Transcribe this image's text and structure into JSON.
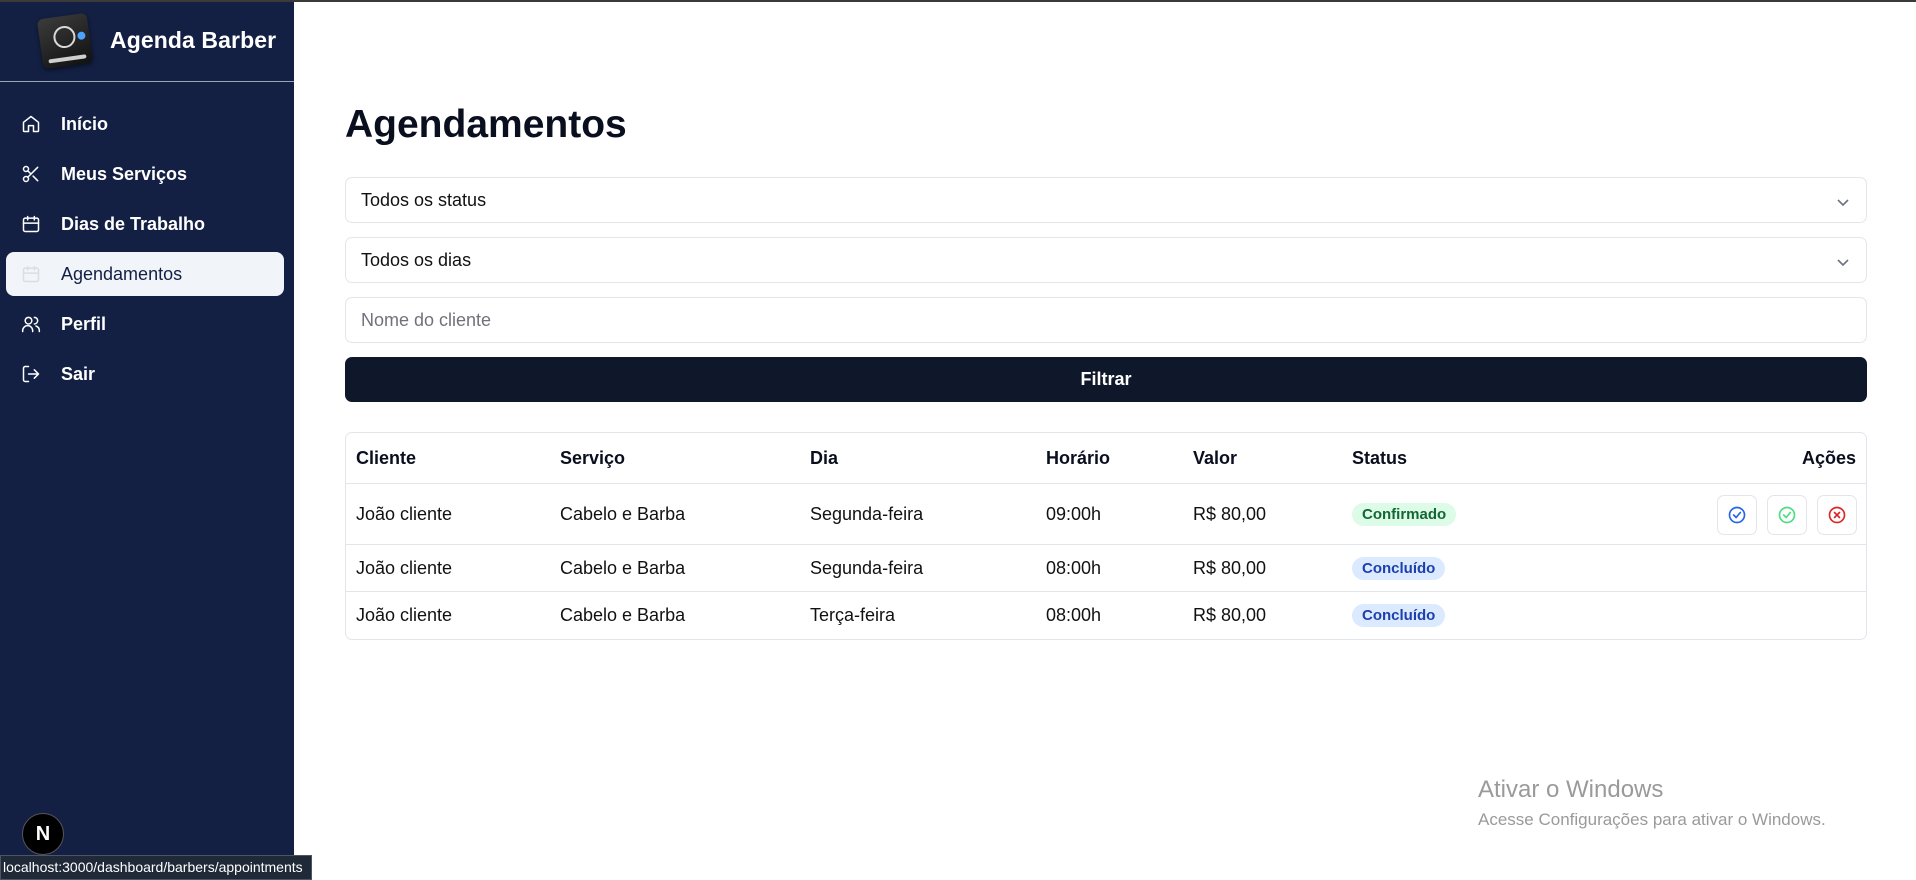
{
  "app": {
    "brand": "Agenda Barber",
    "logo_icon": "agenda-barber-logo"
  },
  "sidebar": {
    "items": [
      {
        "label": "Início",
        "icon": "home-icon",
        "active": false
      },
      {
        "label": "Meus Serviços",
        "icon": "scissors-icon",
        "active": false
      },
      {
        "label": "Dias de Trabalho",
        "icon": "calendar-icon",
        "active": false
      },
      {
        "label": "Agendamentos",
        "icon": "calendar-icon",
        "active": true
      },
      {
        "label": "Perfil",
        "icon": "users-icon",
        "active": false
      },
      {
        "label": "Sair",
        "icon": "logout-icon",
        "active": false
      }
    ],
    "next_badge": "N"
  },
  "status_bar_url": "localhost:3000/dashboard/barbers/appointments",
  "main": {
    "title": "Agendamentos",
    "filters": {
      "status_select": "Todos os status",
      "day_select": "Todos os dias",
      "client_placeholder": "Nome do cliente",
      "client_value": "",
      "button": "Filtrar"
    },
    "table": {
      "headers": [
        "Cliente",
        "Serviço",
        "Dia",
        "Horário",
        "Valor",
        "Status",
        "Ações"
      ],
      "rows": [
        {
          "cliente": "João cliente",
          "servico": "Cabelo e Barba",
          "dia": "Segunda-feira",
          "horario": "09:00h",
          "valor": "R$ 80,00",
          "status": "Confirmado"
        },
        {
          "cliente": "João cliente",
          "servico": "Cabelo e Barba",
          "dia": "Segunda-feira",
          "horario": "08:00h",
          "valor": "R$ 80,00",
          "status": "Concluído"
        },
        {
          "cliente": "João cliente",
          "servico": "Cabelo e Barba",
          "dia": "Terça-feira",
          "horario": "08:00h",
          "valor": "R$ 80,00",
          "status": "Concluído"
        }
      ],
      "row_actions": [
        {
          "icon": "circle-check-icon",
          "color": "#2563eb"
        },
        {
          "icon": "circle-check-icon",
          "color": "#4ade80"
        },
        {
          "icon": "circle-x-icon",
          "color": "#dc2626"
        }
      ]
    }
  },
  "watermark": {
    "line1": "Ativar o Windows",
    "line2": "Acesse Configurações para ativar o Windows."
  },
  "colors": {
    "sidebar_bg": "#132043",
    "primary_button": "#0f172a",
    "confirmed_badge": "#dcfce7",
    "completed_badge": "#dbeafe"
  }
}
